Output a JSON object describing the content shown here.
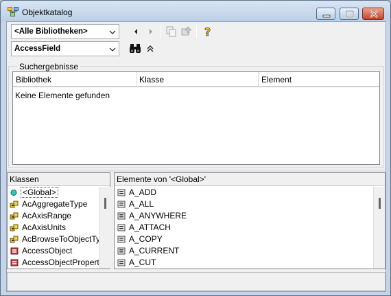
{
  "window": {
    "title": "Objektkatalog"
  },
  "toolbar": {
    "library_combo": "<Alle Bibliotheken>",
    "search_combo": "AccessField"
  },
  "search": {
    "group_label": "Suchergebnisse",
    "columns": [
      "Bibliothek",
      "Klasse",
      "Element"
    ],
    "empty_text": "Keine Elemente gefunden"
  },
  "classes": {
    "header": "Klassen",
    "items": [
      {
        "label": "<Global>",
        "icon": "global-icon"
      },
      {
        "label": "AcAggregateType",
        "icon": "enum-icon"
      },
      {
        "label": "AcAxisRange",
        "icon": "enum-icon"
      },
      {
        "label": "AcAxisUnits",
        "icon": "enum-icon"
      },
      {
        "label": "AcBrowseToObjectType",
        "icon": "enum-icon"
      },
      {
        "label": "AccessObject",
        "icon": "class-icon"
      },
      {
        "label": "AccessObjectProperty",
        "icon": "class-icon"
      }
    ]
  },
  "members": {
    "header": "Elemente von '<Global>'",
    "items": [
      "A_ADD",
      "A_ALL",
      "A_ANYWHERE",
      "A_ATTACH",
      "A_COPY",
      "A_CURRENT",
      "A_CUT"
    ]
  }
}
